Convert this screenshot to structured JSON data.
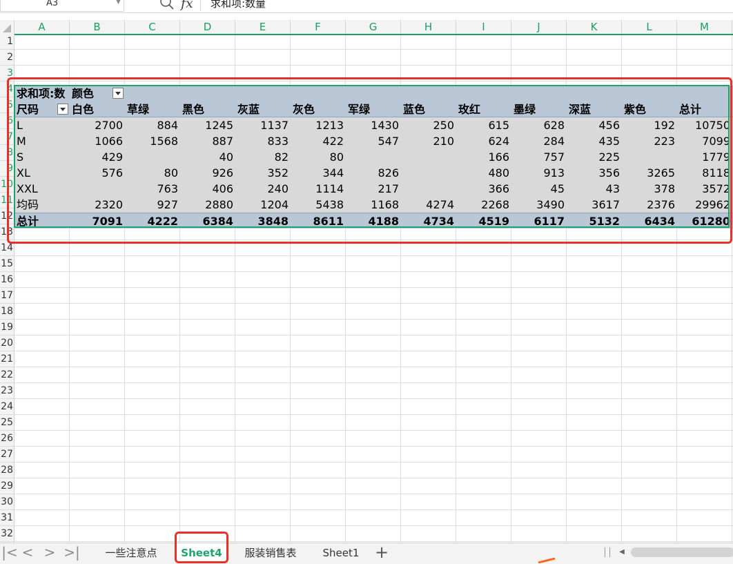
{
  "formula_bar": {
    "name_box": "A3",
    "fx_label": "fx",
    "formula": "求和项:数量"
  },
  "columns": [
    "A",
    "B",
    "C",
    "D",
    "E",
    "F",
    "G",
    "H",
    "I",
    "J",
    "K",
    "L",
    "M"
  ],
  "rows": [
    "1",
    "2",
    "3",
    "4",
    "5",
    "6",
    "7",
    "8",
    "9",
    "10",
    "11",
    "12",
    "13",
    "14",
    "15",
    "16",
    "17",
    "18",
    "19",
    "20",
    "21",
    "22",
    "23",
    "24",
    "25",
    "26",
    "27",
    "28",
    "29",
    "30",
    "31",
    "32"
  ],
  "pivot": {
    "title": "求和项:数",
    "col_field": "颜色",
    "row_field": "尺码",
    "colors": [
      "白色",
      "草绿",
      "黑色",
      "灰蓝",
      "灰色",
      "军绿",
      "蓝色",
      "玫红",
      "墨绿",
      "深蓝",
      "紫色",
      "总计"
    ],
    "body": [
      {
        "size": "L",
        "vals": [
          "2700",
          "884",
          "1245",
          "1137",
          "1213",
          "1430",
          "250",
          "615",
          "628",
          "456",
          "192",
          "10750"
        ]
      },
      {
        "size": "M",
        "vals": [
          "1066",
          "1568",
          "887",
          "833",
          "422",
          "547",
          "210",
          "624",
          "284",
          "435",
          "223",
          "7099"
        ]
      },
      {
        "size": "S",
        "vals": [
          "429",
          "",
          "40",
          "82",
          "80",
          "",
          "",
          "166",
          "757",
          "225",
          "",
          "1779"
        ]
      },
      {
        "size": "XL",
        "vals": [
          "576",
          "80",
          "926",
          "352",
          "344",
          "826",
          "",
          "480",
          "913",
          "356",
          "3265",
          "8118"
        ]
      },
      {
        "size": "XXL",
        "vals": [
          "",
          "763",
          "406",
          "240",
          "1114",
          "217",
          "",
          "366",
          "45",
          "43",
          "378",
          "3572"
        ]
      },
      {
        "size": "均码",
        "vals": [
          "2320",
          "927",
          "2880",
          "1204",
          "5438",
          "1168",
          "4274",
          "2268",
          "3490",
          "3617",
          "2376",
          "29962"
        ]
      }
    ],
    "total": {
      "label": "总计",
      "vals": [
        "7091",
        "4222",
        "6384",
        "3848",
        "8611",
        "4188",
        "4734",
        "4519",
        "6117",
        "5132",
        "6434",
        "61280"
      ]
    }
  },
  "tabs": {
    "nav": [
      "|<",
      "<",
      ">",
      ">|"
    ],
    "sheets": [
      "一些注意点",
      "Sheet4",
      "服装销售表",
      "Sheet1"
    ],
    "active": "Sheet4",
    "add": "+"
  },
  "colors_used": {
    "accent_green": "#1ea36a",
    "highlight_red": "#e5312a",
    "pivot_header": "#b9c7d6",
    "pivot_body": "#d9d9d9"
  }
}
